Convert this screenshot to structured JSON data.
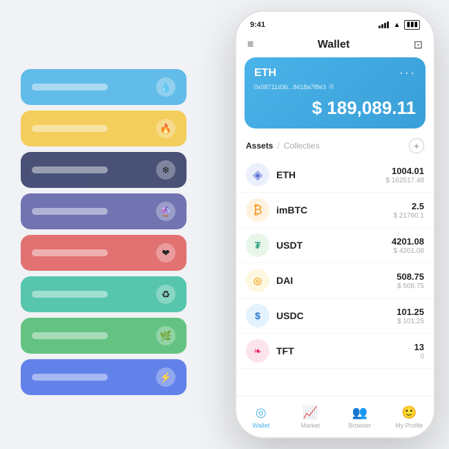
{
  "status_bar": {
    "time": "9:41"
  },
  "header": {
    "title": "Wallet",
    "menu_icon": "≡",
    "scan_icon": "⛶"
  },
  "wallet_card": {
    "coin": "ETH",
    "address": "0x08711d3b...8418a7f8e3",
    "balance": "$ 189,089.11",
    "dots": "···"
  },
  "assets_section": {
    "tab_active": "Assets",
    "tab_divider": "/",
    "tab_inactive": "Collecties",
    "add_label": "+"
  },
  "assets": [
    {
      "id": "eth",
      "icon": "◈",
      "name": "ETH",
      "amount": "1004.01",
      "fiat": "$ 162517.48",
      "icon_class": "icon-eth"
    },
    {
      "id": "imbtc",
      "icon": "₿",
      "name": "imBTC",
      "amount": "2.5",
      "fiat": "$ 21760.1",
      "icon_class": "icon-imbtc"
    },
    {
      "id": "usdt",
      "icon": "₮",
      "name": "USDT",
      "amount": "4201.08",
      "fiat": "$ 4201.08",
      "icon_class": "icon-usdt"
    },
    {
      "id": "dai",
      "icon": "◎",
      "name": "DAI",
      "amount": "508.75",
      "fiat": "$ 508.75",
      "icon_class": "icon-dai"
    },
    {
      "id": "usdc",
      "icon": "$",
      "name": "USDC",
      "amount": "101.25",
      "fiat": "$ 101.25",
      "icon_class": "icon-usdc"
    },
    {
      "id": "tft",
      "icon": "❧",
      "name": "TFT",
      "amount": "13",
      "fiat": "0",
      "icon_class": "icon-tft"
    }
  ],
  "nav": [
    {
      "id": "wallet",
      "icon": "◎",
      "label": "Wallet",
      "active": true
    },
    {
      "id": "market",
      "icon": "📊",
      "label": "Market",
      "active": false
    },
    {
      "id": "browser",
      "icon": "👤",
      "label": "Browser",
      "active": false
    },
    {
      "id": "profile",
      "icon": "🙂",
      "label": "My Profile",
      "active": false
    }
  ],
  "cards": [
    {
      "color": "card-blue",
      "icon": "💧"
    },
    {
      "color": "card-yellow",
      "icon": "🔥"
    },
    {
      "color": "card-dark",
      "icon": "❄"
    },
    {
      "color": "card-purple",
      "icon": "🔮"
    },
    {
      "color": "card-red",
      "icon": "❤"
    },
    {
      "color": "card-teal",
      "icon": "♻"
    },
    {
      "color": "card-green",
      "icon": "🌿"
    },
    {
      "color": "card-royalblue",
      "icon": "⚡"
    }
  ]
}
